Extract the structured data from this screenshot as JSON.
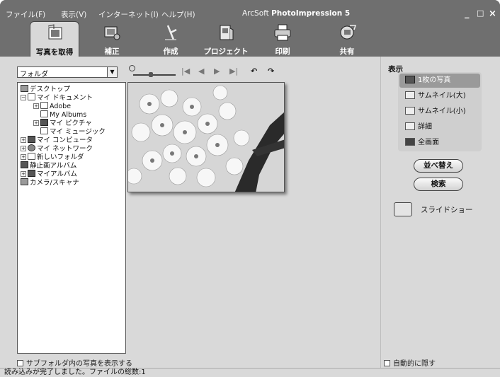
{
  "menu": [
    "ファイル(F)",
    "表示(V)",
    "インターネット(I)",
    "ヘルプ(H)"
  ],
  "app_title": {
    "brand": "ArcSoft",
    "product": "PhotoImpression 5"
  },
  "window_controls": [
    "_",
    "□",
    "×"
  ],
  "toolbar": [
    "写真を取得",
    "補正",
    "作成",
    "プロジェクト",
    "印刷",
    "共有"
  ],
  "folder_select": {
    "value": "フォルダ"
  },
  "tree": [
    {
      "label": "デスクトップ",
      "toggle": ""
    },
    {
      "label": "マイ ドキュメント",
      "toggle": "−"
    },
    {
      "label": "Adobe",
      "toggle": "+"
    },
    {
      "label": "My Albums",
      "toggle": ""
    },
    {
      "label": "マイ ピクチャ",
      "toggle": "+"
    },
    {
      "label": "マイ ミュージック",
      "toggle": ""
    },
    {
      "label": "マイ コンピュータ",
      "toggle": "+"
    },
    {
      "label": "マイ ネットワーク",
      "toggle": "+"
    },
    {
      "label": "新しいフォルダ",
      "toggle": "+"
    },
    {
      "label": "静止画アルバム",
      "toggle": ""
    },
    {
      "label": "マイアルバム",
      "toggle": "+"
    },
    {
      "label": "カメラ/スキャナ",
      "toggle": ""
    }
  ],
  "subfolder_checkbox": "サブフォルダ内の写真を表示する",
  "view_panel": {
    "label": "表示",
    "options": [
      "1枚の写真",
      "サムネイル(大)",
      "サムネイル(小)",
      "詳細",
      "全画面"
    ],
    "sort_button": "並べ替え",
    "search_button": "検索",
    "slideshow": "スライドショー",
    "autohide": "自動的に隠す"
  },
  "status": "読み込みが完了しました。ファイルの総数:1"
}
